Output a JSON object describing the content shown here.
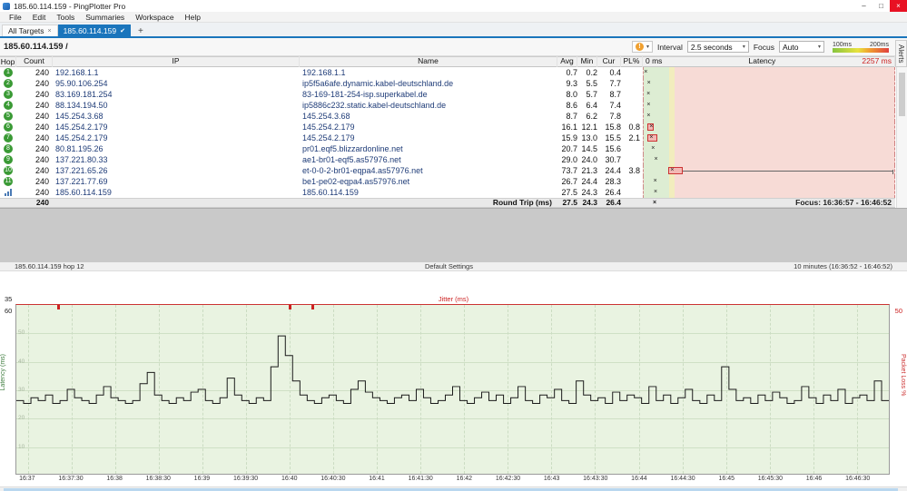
{
  "window": {
    "title": "185.60.114.159 - PingPlotter Pro"
  },
  "icons": {
    "minimize": "–",
    "maximize": "□",
    "close": "×",
    "tab_close": "×",
    "tab_check": "✔",
    "add_tab": "+",
    "dropdown": "▾",
    "alert": "!",
    "marker": "×"
  },
  "menu": [
    "File",
    "Edit",
    "Tools",
    "Summaries",
    "Workspace",
    "Help"
  ],
  "tabs": {
    "all_targets": "All Targets",
    "active": "185.60.114.159"
  },
  "alerts": {
    "label": "Alerts"
  },
  "target_bar": {
    "title": "185.60.114.159 /",
    "interval_label": "Interval",
    "interval_value": "2.5 seconds",
    "focus_label": "Focus",
    "focus_value": "Auto",
    "legend_100": "100ms",
    "legend_200": "200ms"
  },
  "table": {
    "headers": {
      "hop": "Hop",
      "count": "Count",
      "ip": "IP",
      "name": "Name",
      "avg": "Avg",
      "min": "Min",
      "cur": "Cur",
      "pl": "PL%",
      "latency": "Latency",
      "scale_min": "0 ms",
      "scale_max": "2257 ms"
    },
    "rows": [
      {
        "hop": "1",
        "count": "240",
        "ip": "192.168.1.1",
        "name": "192.168.1.1",
        "avg": "0.7",
        "min": "0.2",
        "cur": "0.4",
        "pl": ""
      },
      {
        "hop": "2",
        "count": "240",
        "ip": "95.90.106.254",
        "name": "ip5f5a6afe.dynamic.kabel-deutschland.de",
        "avg": "9.3",
        "min": "5.5",
        "cur": "7.7",
        "pl": ""
      },
      {
        "hop": "3",
        "count": "240",
        "ip": "83.169.181.254",
        "name": "83-169-181-254-isp.superkabel.de",
        "avg": "8.0",
        "min": "5.7",
        "cur": "8.7",
        "pl": ""
      },
      {
        "hop": "4",
        "count": "240",
        "ip": "88.134.194.50",
        "name": "ip5886c232.static.kabel-deutschland.de",
        "avg": "8.6",
        "min": "6.4",
        "cur": "7.4",
        "pl": ""
      },
      {
        "hop": "5",
        "count": "240",
        "ip": "145.254.3.68",
        "name": "145.254.3.68",
        "avg": "8.7",
        "min": "6.2",
        "cur": "7.8",
        "pl": ""
      },
      {
        "hop": "6",
        "count": "240",
        "ip": "145.254.2.179",
        "name": "145.254.2.179",
        "avg": "16.1",
        "min": "12.1",
        "cur": "15.8",
        "pl": "0.8"
      },
      {
        "hop": "7",
        "count": "240",
        "ip": "145.254.2.179",
        "name": "145.254.2.179",
        "avg": "15.9",
        "min": "13.0",
        "cur": "15.5",
        "pl": "2.1"
      },
      {
        "hop": "8",
        "count": "240",
        "ip": "80.81.195.26",
        "name": "pr01.eqf5.blizzardonline.net",
        "avg": "20.7",
        "min": "14.5",
        "cur": "15.6",
        "pl": ""
      },
      {
        "hop": "9",
        "count": "240",
        "ip": "137.221.80.33",
        "name": "ae1-br01-eqf5.as57976.net",
        "avg": "29.0",
        "min": "24.0",
        "cur": "30.7",
        "pl": ""
      },
      {
        "hop": "10",
        "count": "240",
        "ip": "137.221.65.26",
        "name": "et-0-0-2-br01-eqpa4.as57976.net",
        "avg": "73.7",
        "min": "21.3",
        "cur": "24.4",
        "pl": "3.8",
        "whisker": true
      },
      {
        "hop": "11",
        "count": "240",
        "ip": "137.221.77.69",
        "name": "be1-pe02-eqpa4.as57976.net",
        "avg": "26.7",
        "min": "24.4",
        "cur": "28.3",
        "pl": ""
      },
      {
        "hop": "12",
        "count": "240",
        "ip": "185.60.114.159",
        "name": "185.60.114.159",
        "avg": "27.5",
        "min": "24.3",
        "cur": "26.4",
        "pl": "",
        "icon": "bars"
      }
    ],
    "round_trip": {
      "count": "240",
      "label": "Round Trip (ms)",
      "avg": "27.5",
      "min": "24.3",
      "cur": "26.4",
      "focus": "Focus: 16:36:57 - 16:46:52"
    }
  },
  "timeline": {
    "header_left": "185.60.114.159 hop 12",
    "header_center": "Default Settings",
    "header_right": "10 minutes (16:36:52 - 16:46:52)",
    "jitter_label": "Jitter (ms)",
    "jitter_max": "35",
    "lat_max": "60",
    "pl_max": "50",
    "y_label_left": "Latency (ms)",
    "y_label_right": "Packet Loss %",
    "y_gridlines": [
      "50",
      "40",
      "30",
      "20",
      "10"
    ],
    "x_ticks": [
      "16:37",
      "16:37:30",
      "16:38",
      "16:38:30",
      "16:39",
      "16:39:30",
      "16:40",
      "16:40:30",
      "16:41",
      "16:41:30",
      "16:42",
      "16:42:30",
      "16:43",
      "16:43:30",
      "16:44",
      "16:44:30",
      "16:45",
      "16:45:30",
      "16:46",
      "16:46:30"
    ],
    "loss_marks_pct": [
      4.7,
      31.2,
      33.8
    ],
    "points": [
      26,
      25,
      27,
      26,
      28,
      25,
      26,
      30,
      27,
      26,
      25,
      28,
      31,
      27,
      26,
      25,
      26,
      32,
      36,
      28,
      26,
      25,
      27,
      26,
      29,
      30,
      26,
      25,
      27,
      34,
      28,
      26,
      25,
      27,
      26,
      38,
      49,
      42,
      33,
      28,
      26,
      25,
      27,
      28,
      26,
      25,
      30,
      33,
      29,
      27,
      26,
      25,
      27,
      28,
      26,
      30,
      27,
      25,
      26,
      28,
      31,
      26,
      25,
      27,
      29,
      26,
      28,
      25,
      27,
      31,
      26,
      25,
      28,
      27,
      30,
      26,
      25,
      33,
      28,
      26,
      27,
      25,
      29,
      26,
      28,
      27,
      25,
      31,
      26,
      28,
      25,
      27,
      30,
      26,
      25,
      28,
      26,
      38,
      30,
      26,
      27,
      25,
      28,
      26,
      29,
      27,
      25,
      26,
      31,
      27,
      25,
      28,
      26,
      30,
      25,
      27,
      28,
      26,
      33,
      26
    ]
  }
}
